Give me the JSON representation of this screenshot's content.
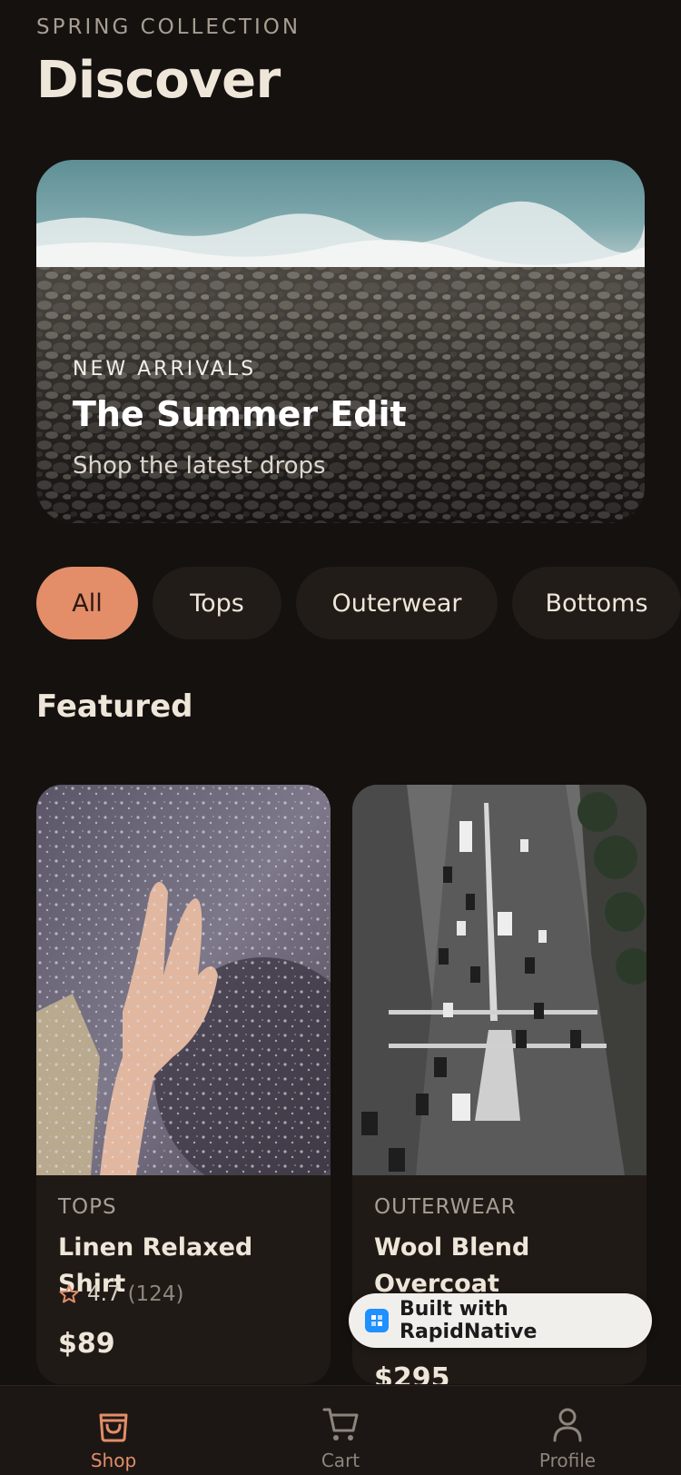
{
  "header": {
    "eyebrow": "SPRING COLLECTION",
    "title": "Discover"
  },
  "hero": {
    "eyebrow": "NEW ARRIVALS",
    "title": "The Summer Edit",
    "subtitle": "Shop the latest drops"
  },
  "chips": [
    {
      "label": "All",
      "active": true
    },
    {
      "label": "Tops",
      "active": false
    },
    {
      "label": "Outerwear",
      "active": false
    },
    {
      "label": "Bottoms",
      "active": false
    }
  ],
  "featured": {
    "title": "Featured",
    "products": [
      {
        "category": "TOPS",
        "name": "Linen Relaxed Shirt",
        "rating": "4.7",
        "reviews": "(124)",
        "price": "$89"
      },
      {
        "category": "OUTERWEAR",
        "name": "Wool Blend Overcoat",
        "price": "$295"
      }
    ]
  },
  "badge": {
    "label": "Built with RapidNative"
  },
  "tabs": [
    {
      "label": "Shop",
      "icon": "bag-icon",
      "active": true
    },
    {
      "label": "Cart",
      "icon": "cart-icon",
      "active": false
    },
    {
      "label": "Profile",
      "icon": "person-icon",
      "active": false
    }
  ],
  "colors": {
    "background": "#15110e",
    "accent": "#e48d69",
    "chip": "#221c18",
    "card": "#201a16"
  }
}
